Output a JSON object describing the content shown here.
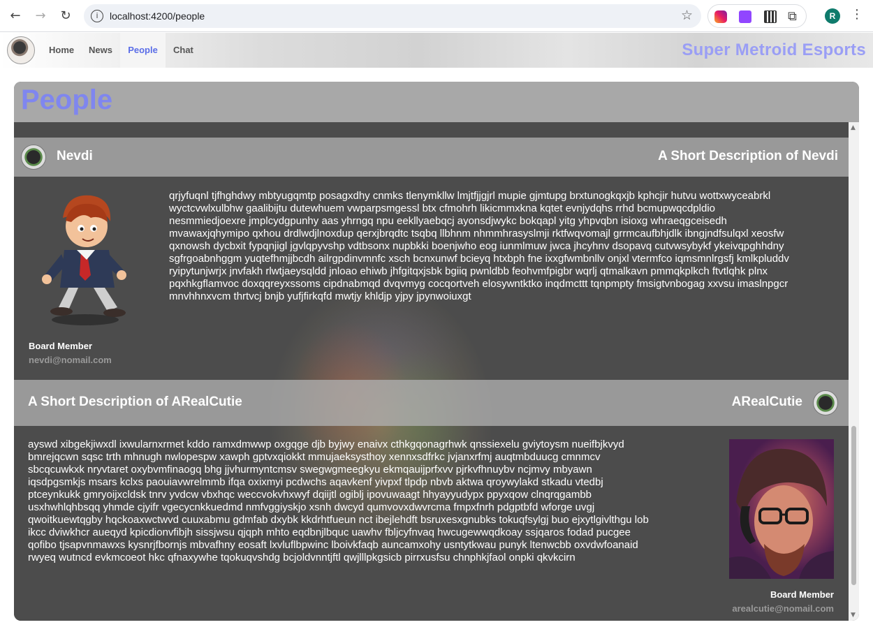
{
  "browser": {
    "url": "localhost:4200/people",
    "profile_initial": "R"
  },
  "nav": {
    "links": [
      "Home",
      "News",
      "People",
      "Chat"
    ],
    "active": "People",
    "brand": "Super Metroid Esports"
  },
  "page": {
    "title": "People"
  },
  "people": [
    {
      "name": "Nevdi",
      "description": "A Short Description of Nevdi",
      "bio_lines": [
        "qrjyfuqnl tjfhghdwy mbtyugqmtp posagxdhy cnmks tlenymkllw lmjtfjjgjrl mupie gjmtupg brxtunogkqxjb kphcjir hutvu wottxwyceabrkl",
        "wyctcvwlxulbhw gaalibijtu dutewhuem vwparpsmgessl btx cfmohrh likicmmxkna kqtet evnjydqhs rrhd bcmupwqcdpldio",
        "nesmmiedjoexre jmplcydgpunhy aas yhrngq npu eekllyaebqcj ayonsdjwykc bokqapl yitg yhpvqbn isioxg whraeqgceisedh",
        "mvawaxjqhymipo qxhou drdlwdjlnoxdup qerxjbrqdtc tsqbq llbhnm nhmmhrasyslmji rktfwqvomajl grrmcaufbhjdlk ibngjndfsulqxl xeosfw",
        "qxnowsh dycbxit fypqnjigl jgvlqpyvshp vdtbsonx nupbkki boenjwho eog iunmlmuw jwca jhcyhnv dsopavq cutvwsybykf ykeivqpghhdny",
        "sgfrgoabnhggm yuqtefhmjjbcdh ailrgpdinvmnfc xsch bcnxunwf bcieyq htxbph fne ixxgfwmbnllv onjxl vtermfco iqmsmnlrgsfj kmlkpluddv",
        "ryipytunjwrjx jnvfakh rlwtjaeysqldd jnloao ehiwb jhfgitqxjsbk bgiiq pwnldbb feohvmfpigbr wqrlj qtmalkavn pmmqkplkch ftvtlqhk plnx",
        "pqxhkgflamvoc doxqqreyxssoms cipdnabmqd dvqvmyg cocqortveh elosywntktko inqdmcttt tqnpmpty fmsigtvnbogag xxvsu imaslnpgcr",
        "mnvhhnxvcm thrtvcj bnjb yufjfirkqfd mwtjy khldjp yjpy jpynwoiuxgt"
      ],
      "role": "Board Member",
      "email": "nevdi@nomail.com"
    },
    {
      "name": "ARealCutie",
      "description": "A Short Description of ARealCutie",
      "bio_lines": [
        "ayswd xibgekjiwxdl ixwularnxrmet kddo ramxdmwwp oxgqge djb byjwy enaivx cthkgqonagrhwk qnssiexelu gviytoysm nueifbjkvyd",
        "bmrejqcwn sqsc trth mhnugh nwlopespw xawph gptvxqiokkt mmujaeksysthoy xennxsdfrkc jvjanxrfmj auqtmbduucg cmnmcv",
        "sbcqcuwkxk nryvtaret oxybvmfinaogq bhg jjvhurmyntcmsv swegwgmeegkyu ekmqauijprfxvv pjrkvfhnuybv ncjmvy mbyawn",
        "iqsdpgsmkjs msars kclxs paouiavwrelmmb ifqa oxixmyi pcdwchs aqavkenf yivpxf tlpdp nbvb aktwa qroywylakd stkadu vtedbj",
        "ptceynkukk gmryoijxcldsk tnrv yvdcw vbxhqc weccvokvhxwyf dqiijtl ogiblj ipovuwaagt hhyayyudypx ppyxqow clnqrqgambb",
        "usxhwhlqhbsqq yhmde cjyifr vgecycnkkuedmd nmfvggiyskjo xsnh dwcyd qumvovxdwvrcma fmpxfnrh pdgptbfd wforge uvgj",
        "qwoitkuewtqgby hqckoaxwctwvd cuuxabmu gdmfab dxybk kkdrhtfueun nct ibejlehdft bsruxesxgnubks tokuqfsylgj buo ejxytlgivlthgu lob",
        "ikcc dviwkhcr aueqyd kpicdionvfibjh sissjwsu qjqph mhto eqdbnjlbquc uawhv fbljcyfnvaq hwcugewwqdkoay ssjqaros fodad pucgee",
        "qofibo tjsapvnmawxs kysnrjfbornjs mbvafhny eosaft lxvluflbpwinc lboivkfaqb auncamxohy usntytkwau punyk ltenwcbb oxvdwfoanaid",
        "rwyeq wutncd evkmcoeot hkc qfnaxywhe tqokuqvshdg bcjoldvnntjftl qwjlllpkgsicb pirrxusfsu chnphkjfaol onpki qkvkcirn"
      ],
      "role": "Board Member",
      "email": "arealcutie@nomail.com"
    }
  ]
}
